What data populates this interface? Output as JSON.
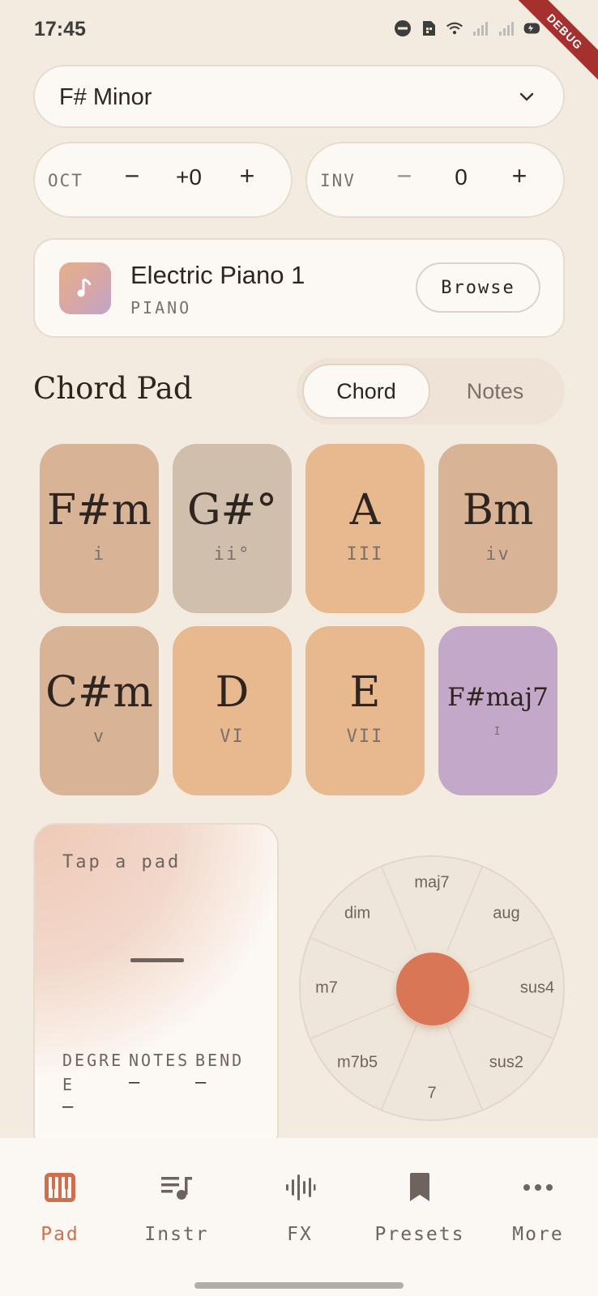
{
  "status_bar": {
    "time": "17:45",
    "icons": [
      "dnd-icon",
      "sim-icon",
      "wifi-icon",
      "signal-icon",
      "signal-icon",
      "battery-charging-icon"
    ],
    "debug_label": "DEBUG"
  },
  "key_select": {
    "value": "F# Minor"
  },
  "octave": {
    "label": "OCT",
    "minus": "−",
    "value": "+0",
    "plus": "+"
  },
  "inversion": {
    "label": "INV",
    "minus": "−",
    "value": "0",
    "plus": "+"
  },
  "instrument": {
    "name": "Electric Piano 1",
    "category": "PIANO",
    "browse_label": "Browse"
  },
  "chord_pad": {
    "title": "Chord Pad",
    "modes": [
      "Chord",
      "Notes"
    ],
    "active_mode": "Chord",
    "pads": [
      {
        "name": "F#m",
        "degree": "i",
        "color": "#d8b396"
      },
      {
        "name": "G#°",
        "degree": "ii°",
        "color": "#cfbfac"
      },
      {
        "name": "A",
        "degree": "III",
        "color": "#e8b98e"
      },
      {
        "name": "Bm",
        "degree": "iv",
        "color": "#d8b396"
      },
      {
        "name": "C#m",
        "degree": "v",
        "color": "#d8b396"
      },
      {
        "name": "D",
        "degree": "VI",
        "color": "#e8b98e"
      },
      {
        "name": "E",
        "degree": "VII",
        "color": "#e8b98e"
      },
      {
        "name": "F#maj7",
        "degree": "I",
        "color": "#c3a8c9"
      }
    ]
  },
  "info_card": {
    "hint": "Tap a pad",
    "current": "—",
    "degree": {
      "label": "DEGREE",
      "value": "—"
    },
    "notes": {
      "label": "NOTES",
      "value": "—"
    },
    "bend": {
      "label": "BEND",
      "value": "—"
    }
  },
  "wheel": {
    "options": [
      "maj7",
      "aug",
      "sus4",
      "sus2",
      "7",
      "m7b5",
      "m7",
      "dim"
    ],
    "center_color": "#d97655"
  },
  "bottom_nav": {
    "items": [
      {
        "label": "Pad",
        "icon": "piano-icon"
      },
      {
        "label": "Instr",
        "icon": "playlist-music-icon"
      },
      {
        "label": "FX",
        "icon": "waveform-icon"
      },
      {
        "label": "Presets",
        "icon": "bookmark-icon"
      },
      {
        "label": "More",
        "icon": "more-horizontal-icon"
      }
    ],
    "active": "Pad",
    "accent": "#cf6f4d"
  }
}
